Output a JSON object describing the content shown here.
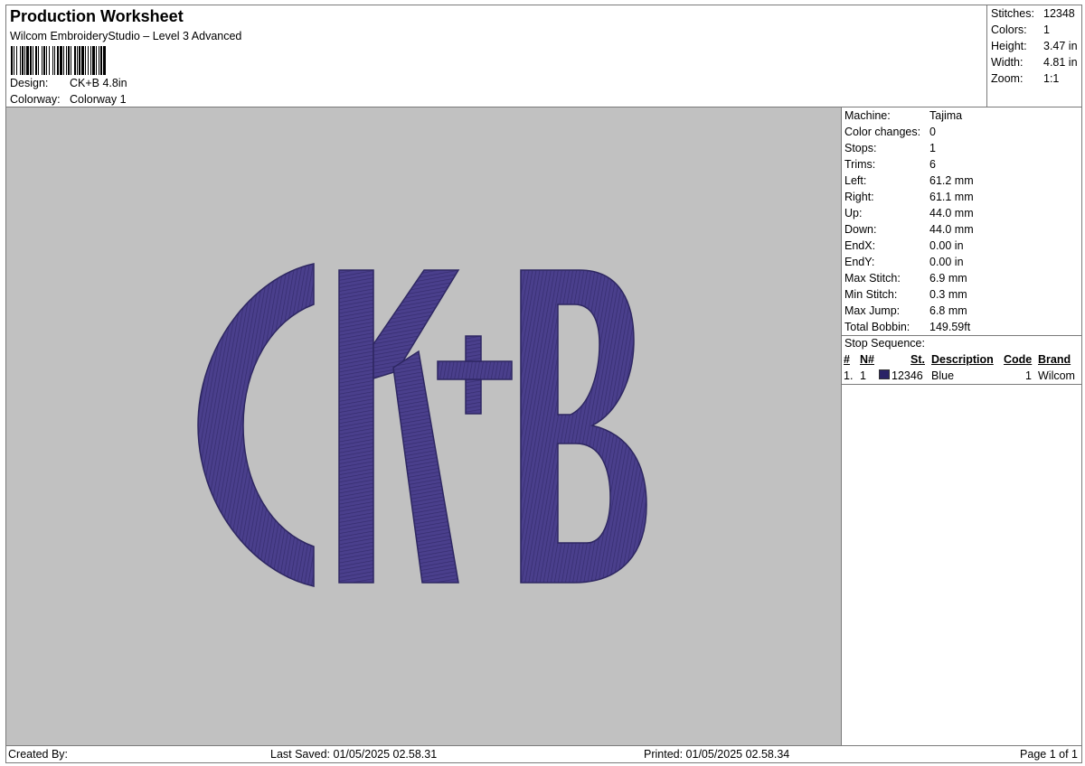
{
  "header": {
    "title": "Production Worksheet",
    "subtitle": "Wilcom EmbroideryStudio – Level 3 Advanced",
    "design_label": "Design:",
    "design_value": "CK+B 4.8in",
    "colorway_label": "Colorway:",
    "colorway_value": "Colorway 1"
  },
  "summary": [
    {
      "label": "Stitches:",
      "value": "12348"
    },
    {
      "label": "Colors:",
      "value": "1"
    },
    {
      "label": "Height:",
      "value": "3.47 in"
    },
    {
      "label": "Width:",
      "value": "4.81 in"
    },
    {
      "label": "Zoom:",
      "value": "1:1"
    }
  ],
  "details": [
    {
      "label": "Machine:",
      "value": "Tajima"
    },
    {
      "label": "Color changes:",
      "value": "0"
    },
    {
      "label": "Stops:",
      "value": "1"
    },
    {
      "label": "Trims:",
      "value": "6"
    },
    {
      "label": "Left:",
      "value": "61.2 mm"
    },
    {
      "label": "Right:",
      "value": "61.1 mm"
    },
    {
      "label": "Up:",
      "value": "44.0 mm"
    },
    {
      "label": "Down:",
      "value": "44.0 mm"
    },
    {
      "label": "EndX:",
      "value": "0.00 in"
    },
    {
      "label": "EndY:",
      "value": "0.00 in"
    },
    {
      "label": "Max Stitch:",
      "value": "6.9 mm"
    },
    {
      "label": "Min Stitch:",
      "value": "0.3 mm"
    },
    {
      "label": "Max Jump:",
      "value": "6.8 mm"
    },
    {
      "label": "Total Bobbin:",
      "value": "149.59ft"
    }
  ],
  "stop_sequence": {
    "title": "Stop Sequence:",
    "headers": {
      "num": "#",
      "n": "N#",
      "st": "St.",
      "description": "Description",
      "code": "Code",
      "brand": "Brand"
    },
    "rows": [
      {
        "num": "1.",
        "n": "1",
        "st": "12346",
        "description": "Blue",
        "code": "1",
        "brand": "Wilcom",
        "color": "#2a2366"
      }
    ]
  },
  "design_preview": {
    "text": "CK+B",
    "thread_color": "#4a3f8c",
    "background_color": "#c1c1c1"
  },
  "footer": {
    "created_by": "Created By:",
    "last_saved": "Last Saved: 01/05/2025 02.58.31",
    "printed": "Printed: 01/05/2025 02.58.34",
    "page": "Page 1 of 1"
  }
}
